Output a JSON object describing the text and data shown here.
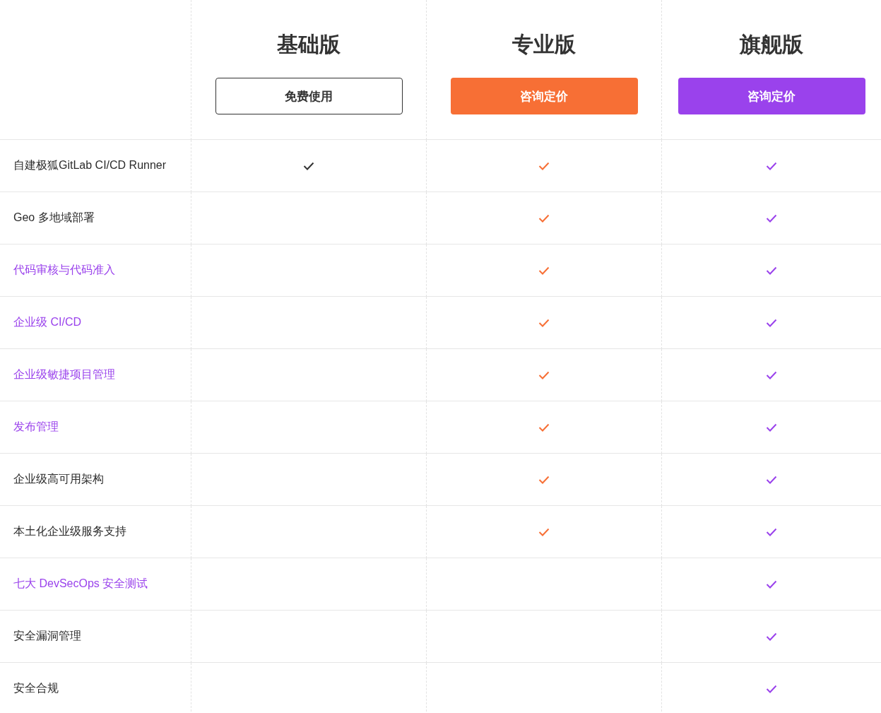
{
  "plans": [
    {
      "name": "基础版",
      "button": "免费使用",
      "kind": "outline",
      "color": "#333333"
    },
    {
      "name": "专业版",
      "button": "咨询定价",
      "kind": "filled",
      "color": "#f76f35"
    },
    {
      "name": "旗舰版",
      "button": "咨询定价",
      "kind": "filled",
      "color": "#9a42ec"
    }
  ],
  "features": [
    {
      "label": "自建极狐GitLab CI/CD Runner",
      "kind": "plain",
      "checks": [
        true,
        true,
        true
      ]
    },
    {
      "label": "Geo 多地域部署",
      "kind": "plain",
      "checks": [
        false,
        true,
        true
      ]
    },
    {
      "label": "代码审核与代码准入",
      "kind": "link",
      "checks": [
        false,
        true,
        true
      ]
    },
    {
      "label": "企业级 CI/CD",
      "kind": "link",
      "checks": [
        false,
        true,
        true
      ]
    },
    {
      "label": "企业级敏捷项目管理",
      "kind": "link",
      "checks": [
        false,
        true,
        true
      ]
    },
    {
      "label": "发布管理",
      "kind": "link",
      "checks": [
        false,
        true,
        true
      ]
    },
    {
      "label": "企业级高可用架构",
      "kind": "plain",
      "checks": [
        false,
        true,
        true
      ]
    },
    {
      "label": "本土化企业级服务支持",
      "kind": "plain",
      "checks": [
        false,
        true,
        true
      ]
    },
    {
      "label": "七大 DevSecOps 安全测试",
      "kind": "link",
      "checks": [
        false,
        false,
        true
      ]
    },
    {
      "label": "安全漏洞管理",
      "kind": "plain",
      "checks": [
        false,
        false,
        true
      ]
    },
    {
      "label": "安全合规",
      "kind": "plain",
      "checks": [
        false,
        false,
        true
      ]
    }
  ]
}
